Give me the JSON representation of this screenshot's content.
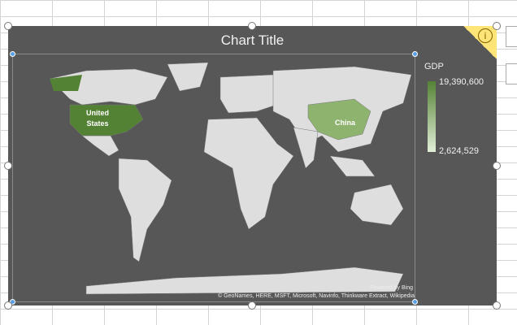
{
  "chart_data": {
    "type": "map",
    "title": "Chart Title",
    "legend": {
      "title": "GDP",
      "max_label": "19,390,600",
      "min_label": "2,624,529",
      "max_color": "#548235",
      "min_color": "#e2efd9",
      "placement": "right"
    },
    "regions": [
      {
        "name": "United States",
        "value": 19390600,
        "label": "United\nStates"
      },
      {
        "name": "China",
        "value": 12237700,
        "label": "China"
      }
    ],
    "credits": {
      "powered": "Powered by Bing",
      "sources": "© GeoNames, HERE, MSFT, Microsoft, Navinfo, Thinkware Extract, Wikipedia"
    }
  },
  "info_icon": "info-icon"
}
